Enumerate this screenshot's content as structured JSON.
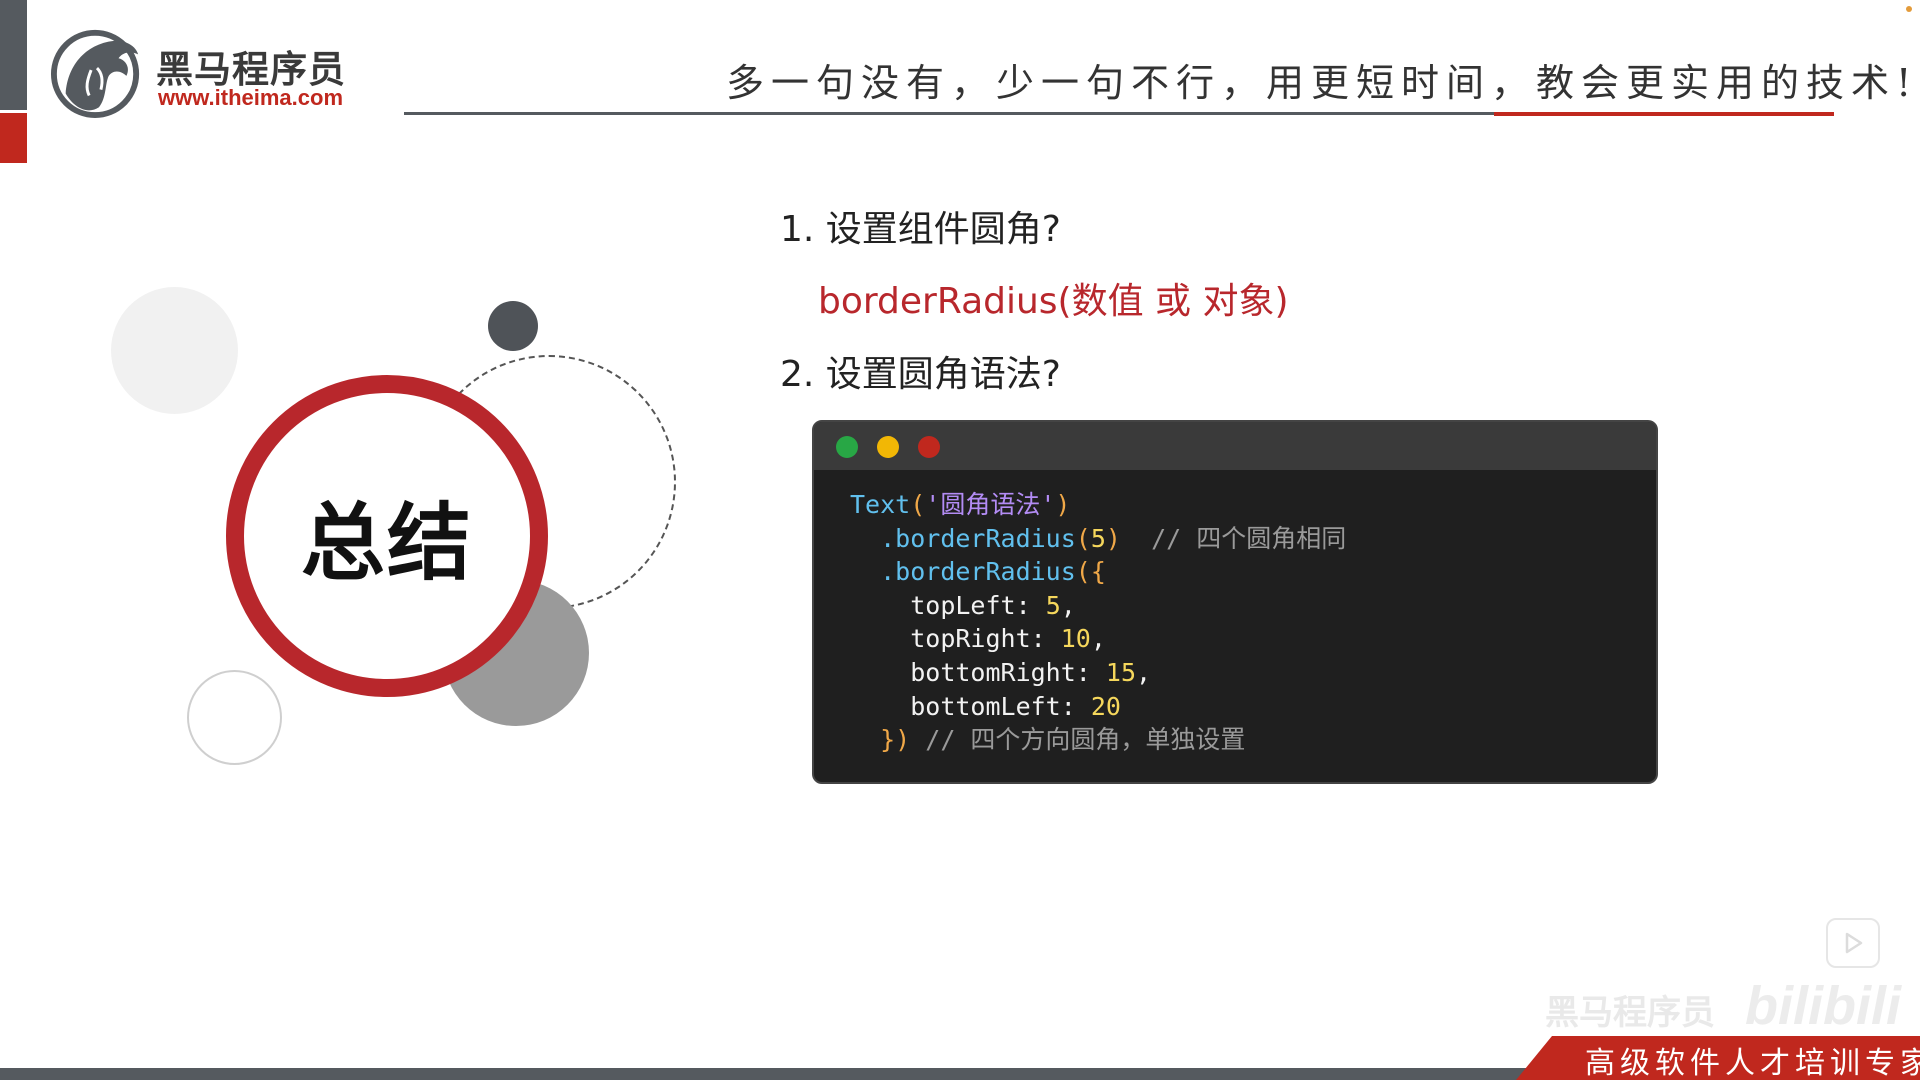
{
  "brand": {
    "name": "黑马程序员",
    "url": "www.itheima.com"
  },
  "slogan": "多一句没有，少一句不行，用更短时间，教会更实用的技术!",
  "summary_title": "总结",
  "questions": [
    {
      "label": "1. 设置组件圆角?",
      "answer": "borderRadius(数值 或 对象)"
    },
    {
      "label": "2. 设置圆角语法?"
    }
  ],
  "code": {
    "line1_fn": "Text",
    "line1_open": "(",
    "line1_str": "'圆角语法'",
    "line1_close": ")",
    "line2_fn": ".borderRadius",
    "line2_open": "(",
    "line2_num": "5",
    "line2_close": ")",
    "line2_comment": "// 四个圆角相同",
    "line3_fn": ".borderRadius",
    "line3_open": "({",
    "props": [
      {
        "key": "topLeft",
        "value": "5",
        "sep": ","
      },
      {
        "key": "topRight",
        "value": "10",
        "sep": ","
      },
      {
        "key": "bottomRight",
        "value": "15",
        "sep": ","
      },
      {
        "key": "bottomLeft",
        "value": "20",
        "sep": ""
      }
    ],
    "last_close": "})",
    "last_comment": "// 四个方向圆角，单独设置"
  },
  "watermark": "黑马程序员",
  "watermark_site": "bilibili",
  "footer_text": "高级软件人才培训专家",
  "colors": {
    "accent_red": "#c0281e",
    "dark_gray": "#555a5f"
  }
}
